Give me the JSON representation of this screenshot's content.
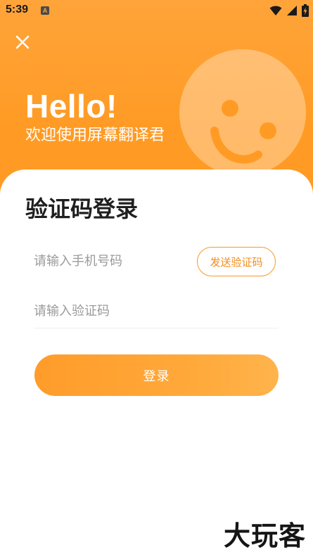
{
  "status_bar": {
    "time": "5:39",
    "app_icon_letter": "A"
  },
  "header": {
    "greeting": "Hello!",
    "subtitle": "欢迎使用屏幕翻译君"
  },
  "login": {
    "title": "验证码登录",
    "phone_placeholder": "请输入手机号码",
    "send_code_label": "发送验证码",
    "code_placeholder": "请输入验证码",
    "submit_label": "登录"
  },
  "watermark": "大玩客",
  "colors": {
    "accent": "#ff9b25",
    "accent_text": "#f08c1a",
    "title_text": "#1f1f1f",
    "placeholder": "#9a9a9a"
  },
  "icons": {
    "close": "close-icon",
    "wifi": "wifi-icon",
    "signal": "signal-icon",
    "battery": "battery-icon",
    "mascot": "smiley-face-icon"
  }
}
